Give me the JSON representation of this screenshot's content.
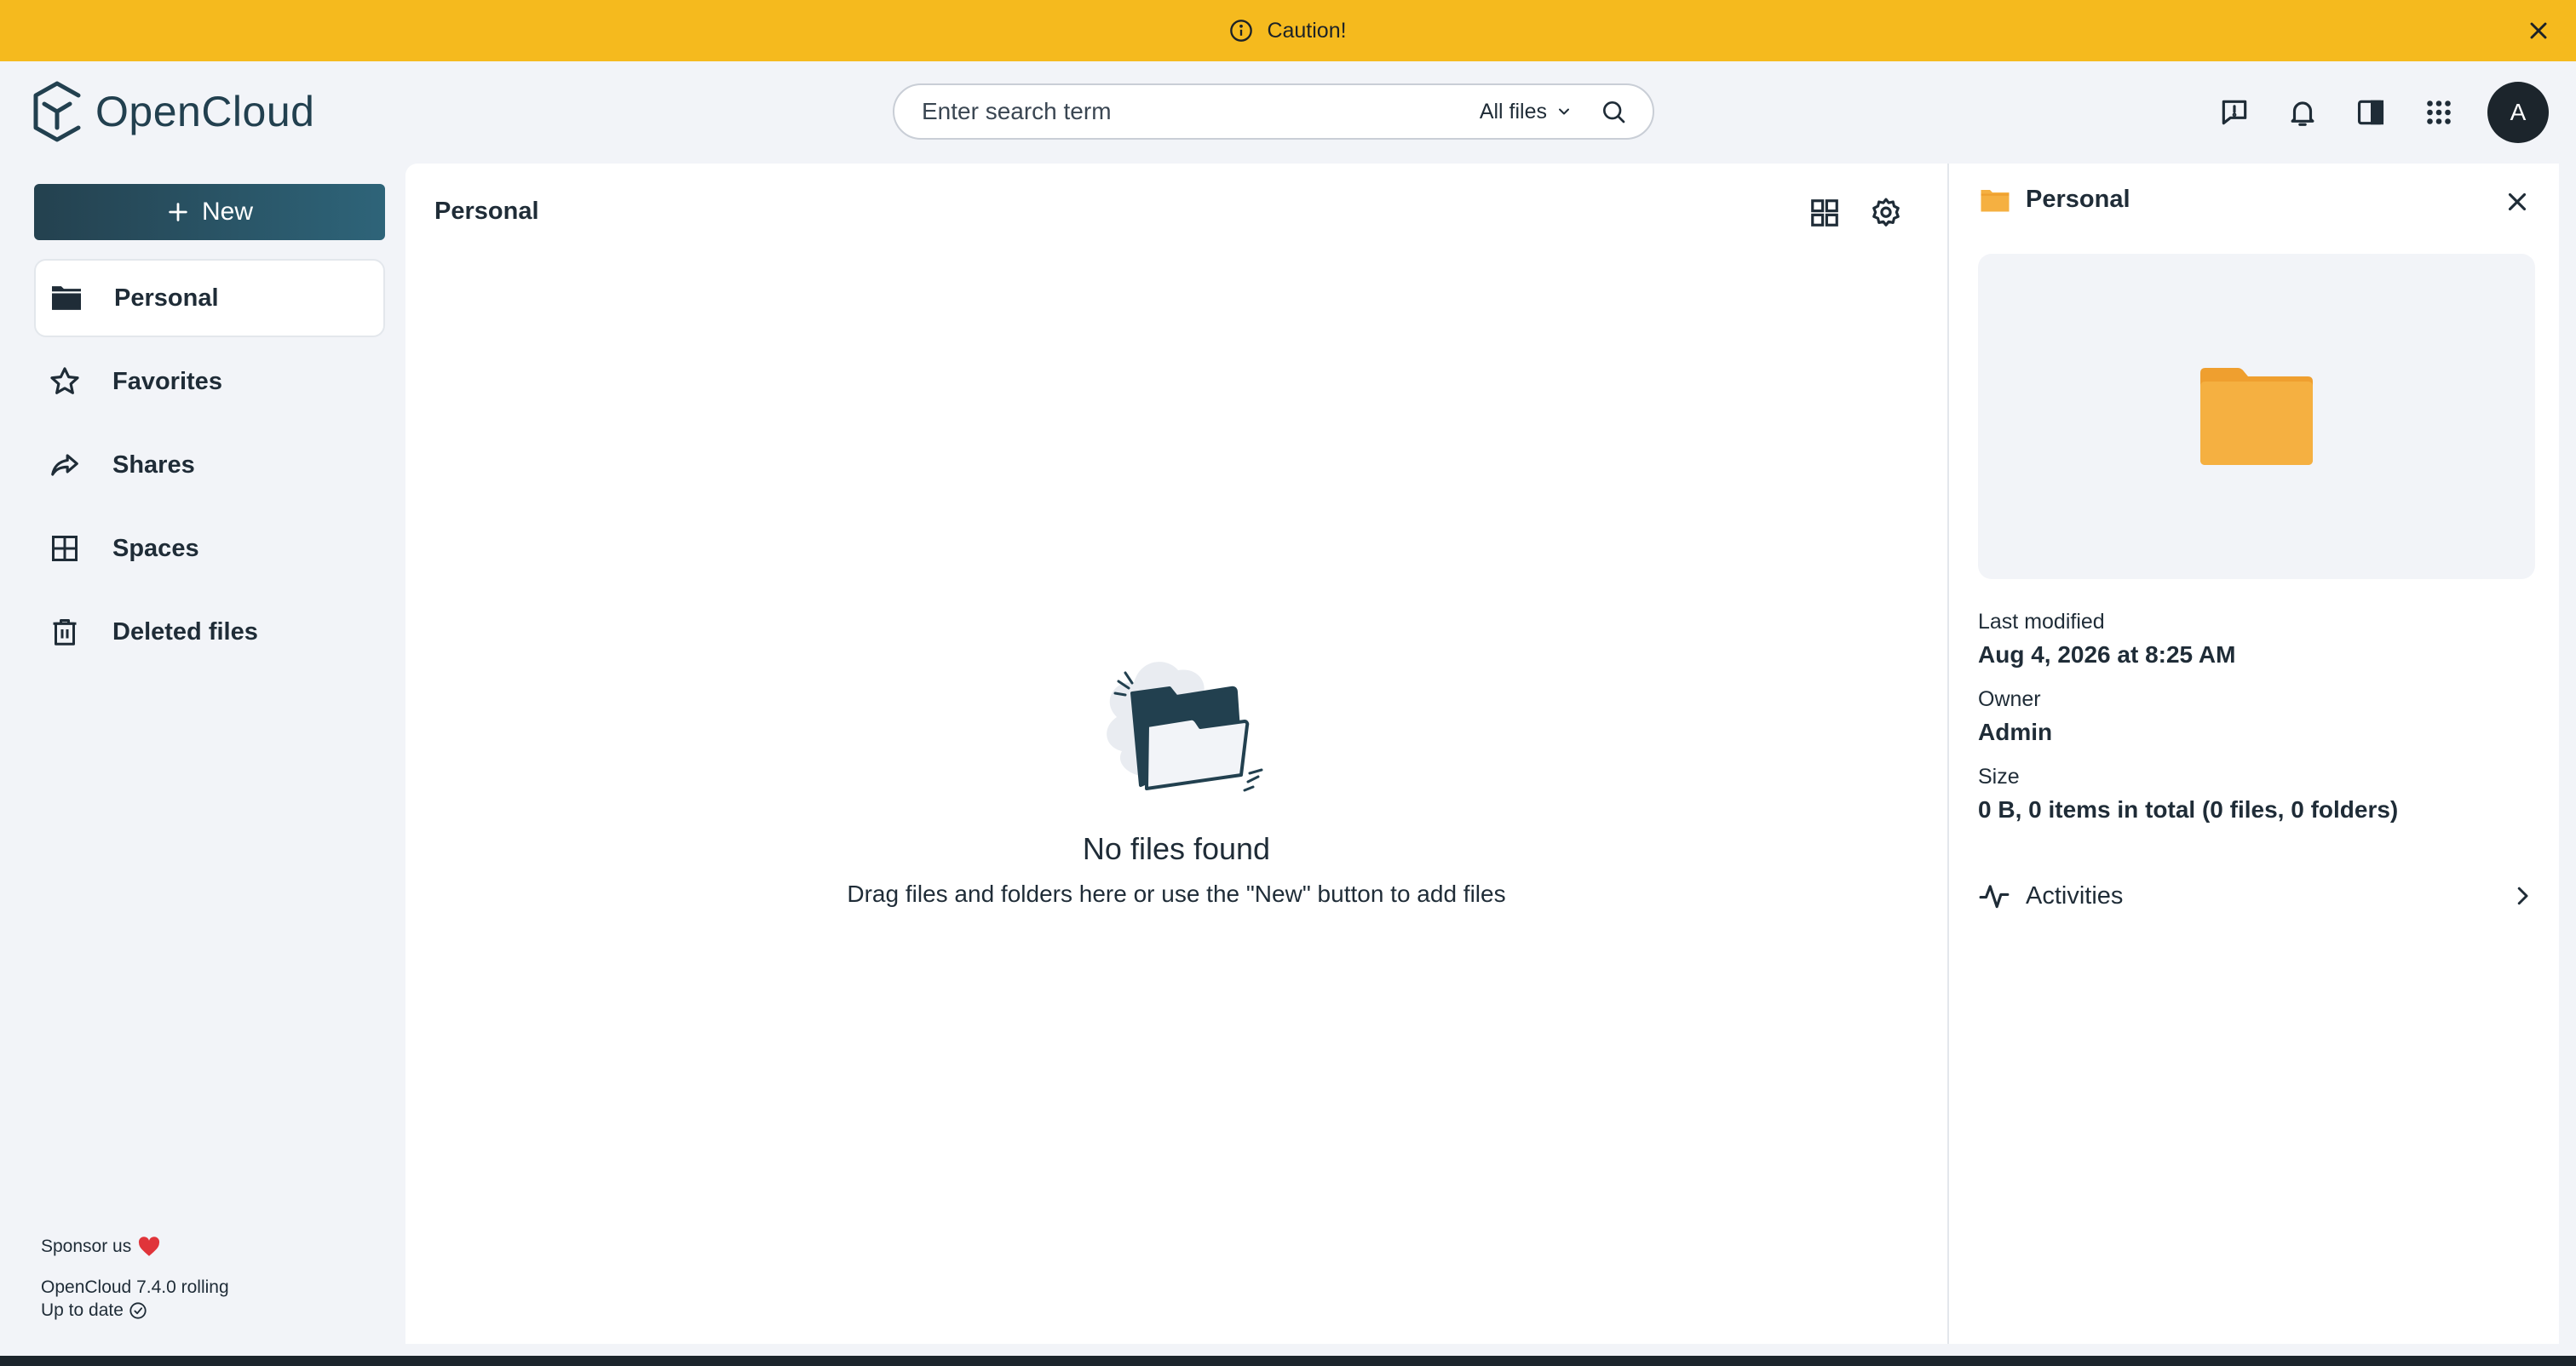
{
  "banner": {
    "text": "Caution!"
  },
  "header": {
    "brand": "OpenCloud",
    "search": {
      "placeholder": "Enter search term",
      "scope": "All files"
    },
    "avatar_initial": "A"
  },
  "sidebar": {
    "new_label": "New",
    "items": [
      {
        "label": "Personal",
        "icon": "folder-icon",
        "active": true
      },
      {
        "label": "Favorites",
        "icon": "star-icon",
        "active": false
      },
      {
        "label": "Shares",
        "icon": "share-icon",
        "active": false
      },
      {
        "label": "Spaces",
        "icon": "spaces-grid-icon",
        "active": false
      },
      {
        "label": "Deleted files",
        "icon": "trash-icon",
        "active": false
      }
    ],
    "footer": {
      "sponsor": "Sponsor us",
      "version": "OpenCloud 7.4.0 rolling",
      "status": "Up to date"
    }
  },
  "main": {
    "title": "Personal",
    "empty": {
      "title": "No files found",
      "subtitle": "Drag files and folders here or use the \"New\" button to add files"
    }
  },
  "panel": {
    "title": "Personal",
    "details": [
      {
        "label": "Last modified",
        "value": "Aug 4, 2026 at 8:25 AM"
      },
      {
        "label": "Owner",
        "value": "Admin"
      },
      {
        "label": "Size",
        "value": "0 B, 0 items in total (0 files, 0 folders)"
      }
    ],
    "activities_label": "Activities"
  },
  "colors": {
    "banner": "#f5ba1e",
    "brand": "#22404f",
    "new_button_start": "#24414f",
    "new_button_end": "#2e6479",
    "folder": "#f5b041"
  }
}
